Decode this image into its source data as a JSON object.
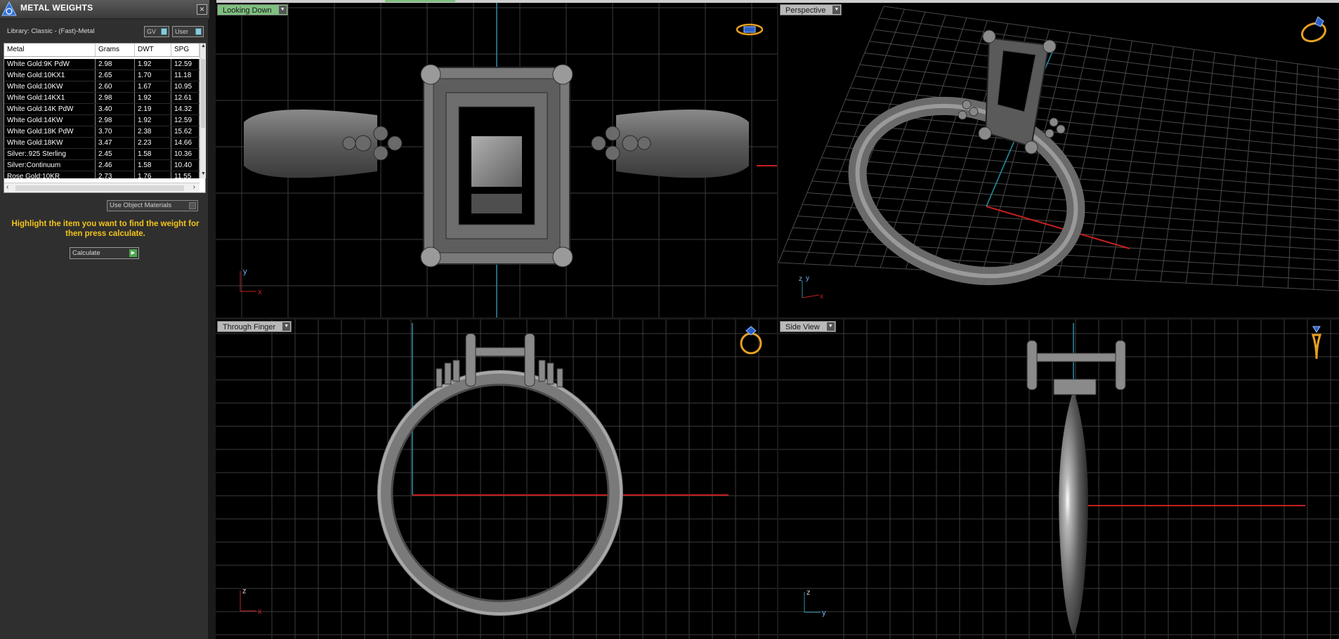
{
  "panel": {
    "title": "METAL WEIGHTS",
    "close_label": "×",
    "library_label": "Library: Classic - (Fast)-Metal",
    "toggles": [
      {
        "label": "GV"
      },
      {
        "label": "User"
      }
    ],
    "table": {
      "headers": [
        "Metal",
        "Grams",
        "DWT",
        "SPG"
      ],
      "rows": [
        [
          "White Gold:9K PdW",
          "2.98",
          "1.92",
          "12.59"
        ],
        [
          "White Gold:10KX1",
          "2.65",
          "1.70",
          "11.18"
        ],
        [
          "White Gold:10KW",
          "2.60",
          "1.67",
          "10.95"
        ],
        [
          "White Gold:14KX1",
          "2.98",
          "1.92",
          "12.61"
        ],
        [
          "White Gold:14K PdW",
          "3.40",
          "2.19",
          "14.32"
        ],
        [
          "White Gold:14KW",
          "2.98",
          "1.92",
          "12.59"
        ],
        [
          "White Gold:18K PdW",
          "3.70",
          "2.38",
          "15.62"
        ],
        [
          "White Gold:18KW",
          "3.47",
          "2.23",
          "14.66"
        ],
        [
          "Silver:.925 Sterling",
          "2.45",
          "1.58",
          "10.36"
        ],
        [
          "Silver:Continuum",
          "2.46",
          "1.58",
          "10.40"
        ],
        [
          "Rose Gold:10KR",
          "2.73",
          "1.76",
          "11.55"
        ]
      ]
    },
    "use_object_materials": "Use Object Materials",
    "hint": "Highlight the item you want to find the weight for then press calculate.",
    "calculate_label": "Calculate"
  },
  "viewports": {
    "top_left": {
      "label": "Looking Down",
      "axes": [
        "y",
        "x"
      ],
      "icon": "ring-top-icon"
    },
    "top_right": {
      "label": "Perspective",
      "axes": [
        "z",
        "y",
        "x"
      ],
      "icon": "ring-perspective-icon"
    },
    "bottom_left": {
      "label": "Through Finger",
      "axes": [
        "z",
        "x"
      ],
      "icon": "ring-front-icon"
    },
    "bottom_right": {
      "label": "Side View",
      "axes": [
        "z",
        "y"
      ],
      "icon": "ring-side-icon"
    }
  },
  "colors": {
    "panel_bg": "#2f2f2f",
    "grid": "#3d3d3d",
    "axis_blue": "#2a8fa8",
    "axis_red": "#c42020",
    "hint_yellow": "#f2c419",
    "label_active": "#7fbf7f",
    "nav_icon": "#e8a020"
  }
}
